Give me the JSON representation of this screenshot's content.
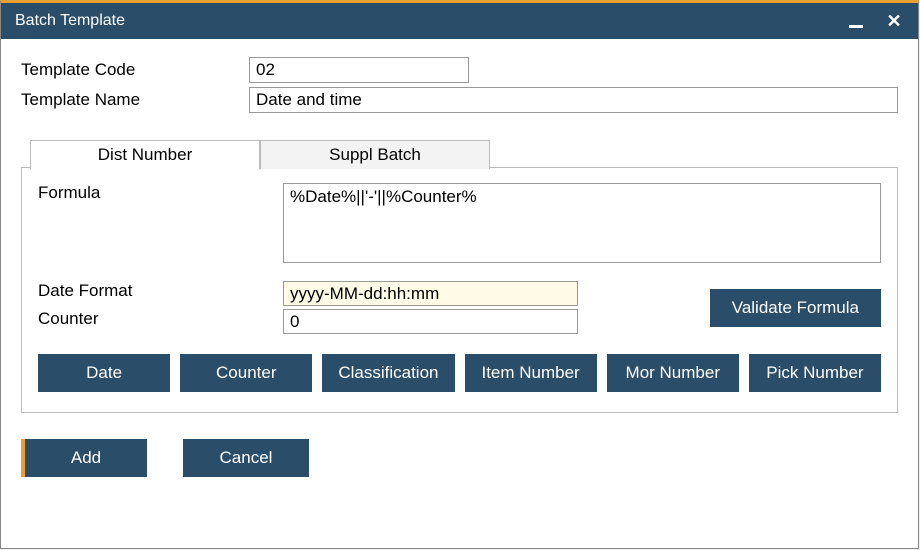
{
  "window": {
    "title": "Batch Template"
  },
  "header": {
    "template_code_label": "Template Code",
    "template_code_value": "02",
    "template_name_label": "Template Name",
    "template_name_value": "Date and time"
  },
  "tabs": {
    "dist_number": "Dist Number",
    "suppl_batch": "Suppl Batch"
  },
  "panel": {
    "formula_label": "Formula",
    "formula_value": "%Date%||'-'||%Counter%",
    "date_format_label": "Date Format",
    "date_format_value": "yyyy-MM-dd:hh:mm",
    "counter_label": "Counter",
    "counter_value": "0",
    "validate_label": "Validate Formula"
  },
  "insert_buttons": {
    "date": "Date",
    "counter": "Counter",
    "classification": "Classification",
    "item_number": "Item Number",
    "mor_number": "Mor Number",
    "pick_number": "Pick Number"
  },
  "footer": {
    "add": "Add",
    "cancel": "Cancel"
  }
}
